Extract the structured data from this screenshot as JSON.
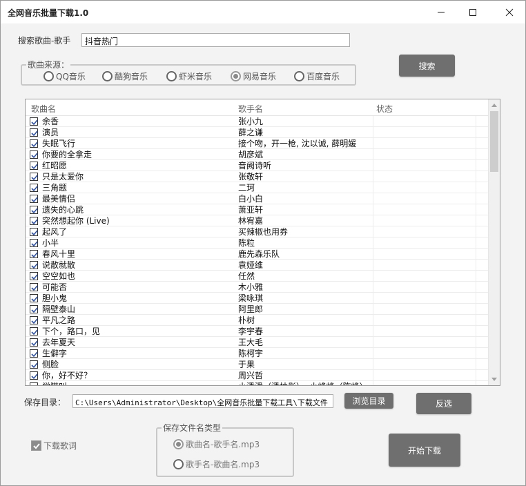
{
  "window": {
    "title": "全网音乐批量下载1.0"
  },
  "search": {
    "label": "搜索歌曲-歌手",
    "value": "抖音热门",
    "button": "搜索"
  },
  "source": {
    "legend": "歌曲来源：",
    "options": [
      {
        "label": "QQ音乐",
        "checked": false
      },
      {
        "label": "酷狗音乐",
        "checked": false
      },
      {
        "label": "虾米音乐",
        "checked": false
      },
      {
        "label": "网易音乐",
        "checked": true
      },
      {
        "label": "百度音乐",
        "checked": false
      }
    ]
  },
  "list": {
    "columns": [
      "歌曲名",
      "歌手名",
      "状态"
    ],
    "rows": [
      {
        "song": "余香",
        "artist": "张小九",
        "status": "",
        "checked": true
      },
      {
        "song": "演员",
        "artist": "薛之谦",
        "status": "",
        "checked": true
      },
      {
        "song": "失眠飞行",
        "artist": "接个吻，开一枪, 沈以诚, 薛明媛",
        "status": "",
        "checked": true
      },
      {
        "song": "你要的全拿走",
        "artist": "胡彦斌",
        "status": "",
        "checked": true
      },
      {
        "song": "红昭愿",
        "artist": "音阙诗听",
        "status": "",
        "checked": true
      },
      {
        "song": "只是太爱你",
        "artist": "张敬轩",
        "status": "",
        "checked": true
      },
      {
        "song": "三角题",
        "artist": "二珂",
        "status": "",
        "checked": true
      },
      {
        "song": "最美情侣",
        "artist": "白小白",
        "status": "",
        "checked": true
      },
      {
        "song": "遗失的心跳",
        "artist": "萧亚轩",
        "status": "",
        "checked": true
      },
      {
        "song": "突然想起你 (Live)",
        "artist": "林宥嘉",
        "status": "",
        "checked": true
      },
      {
        "song": "起风了",
        "artist": "买辣椒也用券",
        "status": "",
        "checked": true
      },
      {
        "song": "小半",
        "artist": "陈粒",
        "status": "",
        "checked": true
      },
      {
        "song": "春风十里",
        "artist": "鹿先森乐队",
        "status": "",
        "checked": true
      },
      {
        "song": "说散就散",
        "artist": "袁娅维",
        "status": "",
        "checked": true
      },
      {
        "song": "空空如也",
        "artist": "任然",
        "status": "",
        "checked": true
      },
      {
        "song": "可能否",
        "artist": "木小雅",
        "status": "",
        "checked": true
      },
      {
        "song": "胆小鬼",
        "artist": "梁咏琪",
        "status": "",
        "checked": true
      },
      {
        "song": "隔壁泰山",
        "artist": "阿里郎",
        "status": "",
        "checked": true
      },
      {
        "song": "平凡之路",
        "artist": "朴树",
        "status": "",
        "checked": true
      },
      {
        "song": "下个，路口，见",
        "artist": "李宇春",
        "status": "",
        "checked": true
      },
      {
        "song": "去年夏天",
        "artist": "王大毛",
        "status": "",
        "checked": true
      },
      {
        "song": "生僻字",
        "artist": "陈柯宇",
        "status": "",
        "checked": true
      },
      {
        "song": "侧脸",
        "artist": "于果",
        "status": "",
        "checked": true
      },
      {
        "song": "你，好不好？",
        "artist": "周兴哲",
        "status": "",
        "checked": true
      },
      {
        "song": "学猫叫",
        "artist": "小潘潘（潘柚彤）, 小峰峰（陈峰）",
        "status": "",
        "checked": true
      }
    ]
  },
  "save": {
    "label": "保存目录：",
    "path": "C:\\Users\\Administrator\\Desktop\\全网音乐批量下载工具\\下载文件",
    "browse_button": "浏览目录",
    "invert_button": "反选"
  },
  "lyrics": {
    "label": "下载歌词",
    "checked": true
  },
  "filename_type": {
    "legend": "保存文件名类型",
    "options": [
      {
        "label": "歌曲名-歌手名.mp3",
        "checked": true
      },
      {
        "label": "歌手名-歌曲名.mp3",
        "checked": false
      }
    ]
  },
  "start_button": "开始下载"
}
